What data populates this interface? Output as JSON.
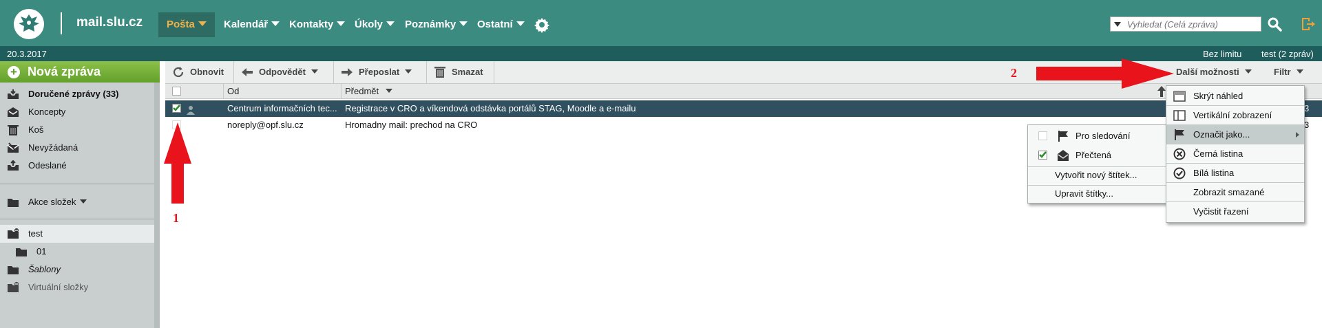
{
  "header": {
    "site_name": "mail.slu.cz",
    "nav": [
      "Pošta",
      "Kalendář",
      "Kontakty",
      "Úkoly",
      "Poznámky",
      "Ostatní"
    ],
    "search_placeholder": "Vyhledat (Celá zpráva)"
  },
  "status": {
    "date": "20.3.2017",
    "quota": "Bez limitu",
    "account": "test (2 zpráv)"
  },
  "sidebar": {
    "new_message": "Nová zpráva",
    "folders": [
      "Doručené zprávy (33)",
      "Koncepty",
      "Koš",
      "Nevyžádaná",
      "Odeslané"
    ],
    "folder_actions": "Akce složek",
    "user_folders": [
      "test",
      "01",
      "Šablony",
      "Virtuální složky"
    ]
  },
  "toolbar": {
    "refresh": "Obnovit",
    "reply": "Odpovědět",
    "forward": "Přeposlat",
    "delete": "Smazat",
    "more_options": "Další možnosti",
    "filter": "Filtr"
  },
  "list": {
    "col_from": "Od",
    "col_subject": "Předmět",
    "rows": [
      {
        "from": "Centrum informačních tec...",
        "subject": "Registrace v CRO a víkendová odstávka portálů STAG, Moodle a e-mailu",
        "date": "3"
      },
      {
        "from": "noreply@opf.slu.cz",
        "subject": "Hromadny mail: prechod na CRO",
        "date": "3"
      }
    ]
  },
  "more_menu": {
    "items": [
      "Skrýt náhled",
      "Vertikální zobrazení",
      "Označit jako...",
      "Černá listina",
      "Bílá listina",
      "Zobrazit smazané",
      "Vyčistit řazení"
    ]
  },
  "mark_menu": {
    "items": [
      "Pro sledování",
      "Přečtená",
      "Vytvořit nový štítek...",
      "Upravit štítky..."
    ]
  },
  "annotations": {
    "one": "1",
    "two": "2"
  },
  "colors": {
    "header": "#3b8b80",
    "statusbar": "#1f5c5c",
    "accent": "#f0b24a",
    "selected_row": "#305060",
    "new_button": "#6aa832",
    "arrow": "#e8131b"
  }
}
